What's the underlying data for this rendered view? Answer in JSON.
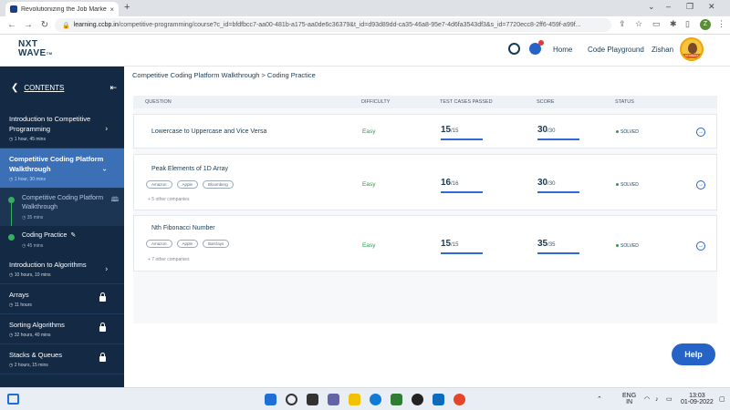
{
  "browser": {
    "tab_title": "Revolutionizing the Job Market |",
    "tab_close": "×",
    "new_tab": "+",
    "url_host": "learning.ccbp.in",
    "url_path": "/competitive-programming/course?c_id=bfdfbcc7-aa00-481b-a175-aa0de6c36379&t_id=d93d89dd-ca35-46a8-95e7-4d6fa3543df3&s_id=7720ecc8-2ff6-459f-a99f...",
    "win_controls": [
      "⌄",
      "–",
      "❐",
      "✕"
    ]
  },
  "header": {
    "logo_line1": "NXT",
    "logo_line2": "WAVE",
    "logo_suffix": "TM",
    "notification_count": "1",
    "home_label": "Home",
    "playground_label": "Code Playground",
    "user_name": "Zishan",
    "profile_badge": "STUDENT"
  },
  "sidebar": {
    "contents_label": "CONTENTS",
    "sections": [
      {
        "title": "Introduction to Competitive Programming",
        "meta": "1 hour, 45 mins"
      },
      {
        "title": "Competitive Coding Platform Walkthrough",
        "meta": "1 hour, 30 mins"
      },
      {
        "title": "Introduction to Algorithms",
        "meta": "10 hours, 10 mins"
      },
      {
        "title": "Arrays",
        "meta": "11 hours"
      },
      {
        "title": "Sorting Algorithms",
        "meta": "32 hours, 40 mins"
      },
      {
        "title": "Stacks & Queues",
        "meta": "2 hours, 15 mins"
      }
    ],
    "sub_items": [
      {
        "title": "Competitive Coding Platform Walkthrough",
        "meta": "35 mins"
      },
      {
        "title": "Coding Practice",
        "meta": "45 mins"
      }
    ]
  },
  "main": {
    "breadcrumb": "Competitive Coding Platform Walkthrough > Coding Practice",
    "columns": [
      "QUESTION",
      "DIFFICULTY",
      "TEST CASES PASSED",
      "SCORE",
      "STATUS"
    ],
    "questions": [
      {
        "name": "Lowercase to Uppercase and Vice Versa",
        "difficulty": "Easy",
        "passed": "15",
        "total": "/15",
        "score": "30",
        "score_total": "/30",
        "status": "SOLVED",
        "tags": [],
        "more": ""
      },
      {
        "name": "Peak Elements of 1D Array",
        "difficulty": "Easy",
        "passed": "16",
        "total": "/16",
        "score": "30",
        "score_total": "/30",
        "status": "SOLVED",
        "tags": [
          "Amazon",
          "Apple",
          "Bloomberg"
        ],
        "more": "+ 5 other companies"
      },
      {
        "name": "Nth Fibonacci Number",
        "difficulty": "Easy",
        "passed": "15",
        "total": "/15",
        "score": "35",
        "score_total": "/35",
        "status": "SOLVED",
        "tags": [
          "Amazon",
          "Apple",
          "Barclays"
        ],
        "more": "+ 7 other companies"
      }
    ],
    "help_label": "Help"
  },
  "taskbar": {
    "lang_line1": "ENG",
    "lang_line2": "IN",
    "time": "13:03",
    "date": "01-09-2022"
  },
  "colors": {
    "sidebar_bg": "#142a44",
    "active_section": "#3b6fb6",
    "accent": "#2563c7",
    "easy": "#2a9d4b"
  }
}
